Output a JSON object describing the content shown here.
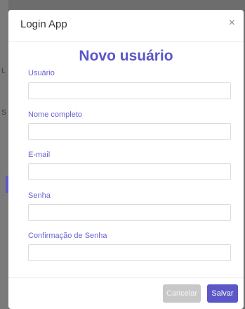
{
  "backdrop": {
    "chars": [
      "L",
      "S",
      "N"
    ]
  },
  "modal": {
    "app_title": "Login App",
    "close_symbol": "×",
    "form_title": "Novo usuário"
  },
  "fields": [
    {
      "label": "Usuário",
      "value": "",
      "placeholder": ""
    },
    {
      "label": "Nome completo",
      "value": "",
      "placeholder": ""
    },
    {
      "label": "E-mail",
      "value": "",
      "placeholder": ""
    },
    {
      "label": "Senha",
      "value": "",
      "placeholder": ""
    },
    {
      "label": "Confirmação de Senha",
      "value": "",
      "placeholder": ""
    }
  ],
  "buttons": {
    "cancel": "Cancelar",
    "save": "Salvar"
  },
  "colors": {
    "accent": "#5b57c7",
    "label": "#6a63d0",
    "cancel_bg": "#c8c8c8",
    "backdrop": "#6d6d6d"
  },
  "icons": {
    "close": "close-icon"
  }
}
